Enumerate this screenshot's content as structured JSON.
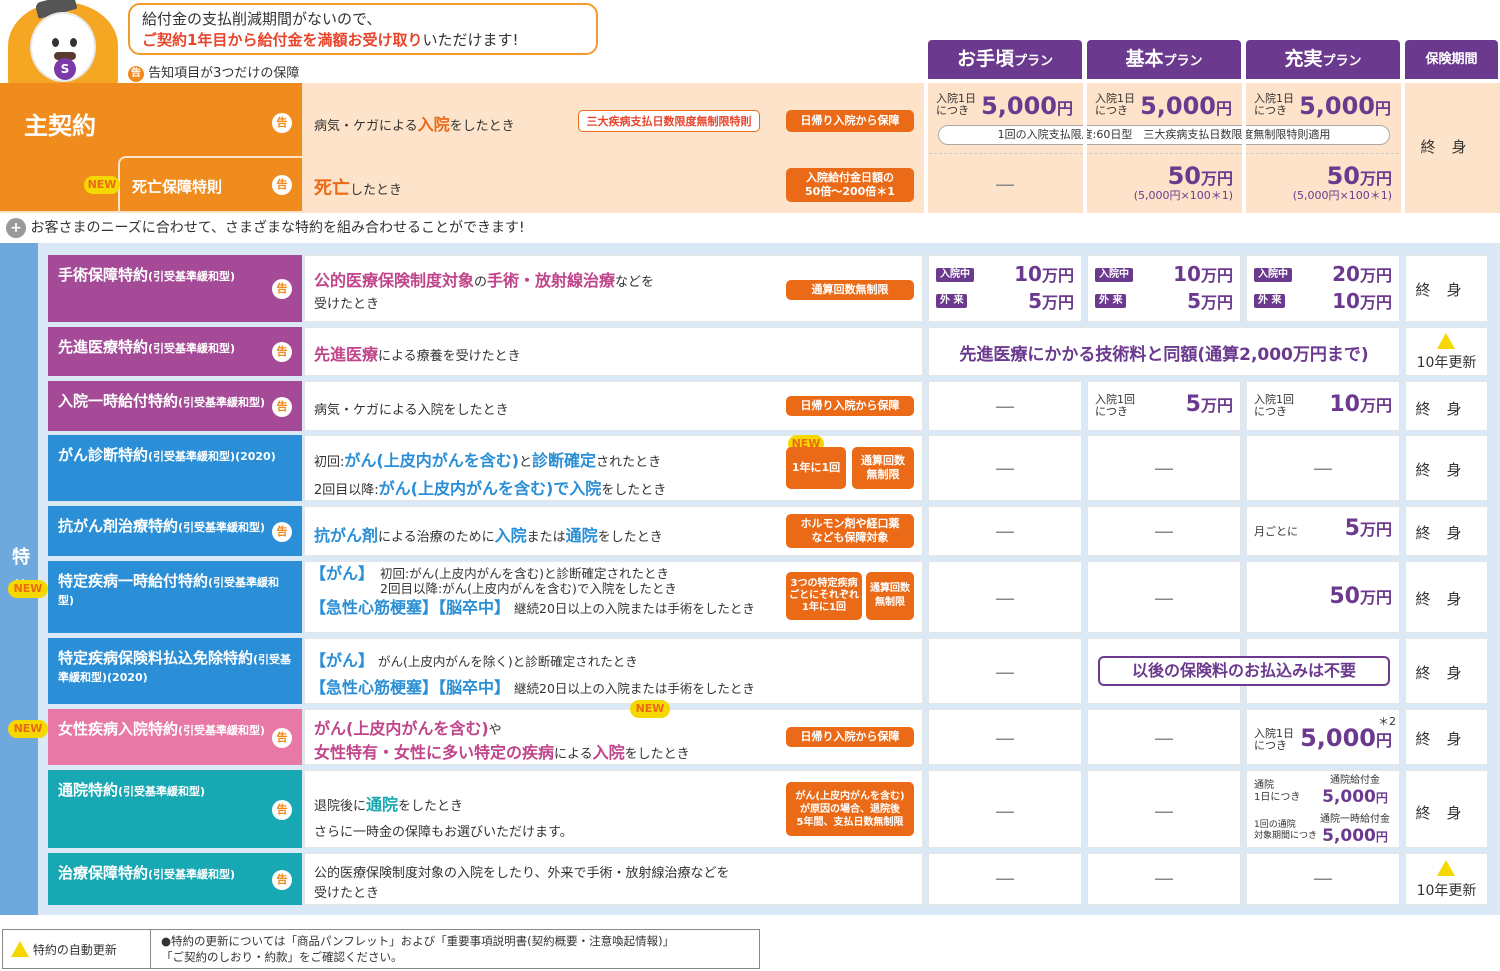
{
  "header": {
    "bubble_line1": "給付金の支払削減期間がないので、",
    "bubble_line2_hl": "ご契約1年目から給付金を満額お受け取り",
    "bubble_line2_rest": "いただけます!",
    "notice": "告知項目が3つだけの保障",
    "mascot_badge": "S",
    "kokuchi_icon": "告",
    "plans": [
      {
        "name": "お手頃",
        "suffix": "プラン"
      },
      {
        "name": "基本",
        "suffix": "プラン"
      },
      {
        "name": "充実",
        "suffix": "プラン"
      }
    ],
    "period_label": "保険期間"
  },
  "main": {
    "label": "主契約",
    "desc_pre": "病気・ケガによる",
    "desc_hl": "入院",
    "desc_post": "をしたとき",
    "tag1": "三大疾病支払日数限度無制限特則",
    "tag2": "日帰り入院から保障",
    "per_day": "入院1日",
    "per_day2": "につき",
    "amount": "5,000",
    "unit": "円",
    "limit_note": "1回の入院支払限度:60日型　三大疾病支払日数限度無制限特則適用",
    "term": "終身",
    "death": {
      "new": "NEW",
      "label": "死亡保障特則",
      "desc_hl": "死亡",
      "desc_post": "したとき",
      "tag": "入院給付金日額の",
      "tag2": "50倍〜200倍＊1",
      "dash": "—",
      "amount": "50",
      "unit": "万円",
      "note": "(5,000円×100＊1)"
    }
  },
  "combo_note": "お客さまのニーズに合わせて、さまざまな特約を組み合わせることができます!",
  "side_label": "特約",
  "riders": [
    {
      "label": "手術保障特約",
      "sub": "(引受基準緩和型)"
    },
    {
      "label": "先進医療特約",
      "sub": "(引受基準緩和型)"
    },
    {
      "label": "入院一時給付特約",
      "sub": "(引受基準緩和型)"
    },
    {
      "label": "がん診断特約",
      "sub": "(引受基準緩和型)(2020)"
    },
    {
      "label": "抗がん剤治療特約",
      "sub": "(引受基準緩和型)"
    },
    {
      "label": "特定疾病一時給付特約",
      "sub": "(引受基準緩和型)"
    },
    {
      "label": "特定疾病保険料払込免除特約",
      "sub": "(引受基準緩和型)(2020)"
    },
    {
      "label": "女性疾病入院特約",
      "sub": "(引受基準緩和型)"
    },
    {
      "label": "通院特約",
      "sub": "(引受基準緩和型)"
    },
    {
      "label": "治療保障特約",
      "sub": "(引受基準緩和型)"
    }
  ],
  "r1": {
    "d1": "公的医療保険制度対象",
    "d2": "の",
    "d3": "手術・放射線治療",
    "d4": "などを",
    "d5": "受けたとき",
    "tag": "通算回数無制限",
    "in": "入院中",
    "out": "外 来",
    "a1": "10",
    "a2": "5",
    "b1": "10",
    "b2": "5",
    "c1": "20",
    "c2": "10",
    "u": "万円",
    "term": "終身"
  },
  "r2": {
    "d1": "先進医療",
    "d2": "による療養を受けたとき",
    "span": "先進医療にかかる技術料と同額(通算2,000万円まで)",
    "term": "10年更新"
  },
  "r3": {
    "d1": "病気・ケガによる入院をしたとき",
    "tag": "日帰り入院から保障",
    "dash": "—",
    "per": "入院1回",
    "per2": "につき",
    "b": "5",
    "c": "10",
    "u": "万円",
    "term": "終身"
  },
  "r4": {
    "l1a": "初回:",
    "l1b": "がん(上皮内がんを含む)",
    "l1c": "と",
    "l1d": "診断確定",
    "l1e": "されたとき",
    "l2a": "2回目以降:",
    "l2b": "がん(上皮内がんを含む)で入院",
    "l2c": "をしたとき",
    "new": "NEW",
    "tag1": "1年に1回",
    "tag2a": "通算回数",
    "tag2b": "無制限",
    "dash": "—",
    "term": "終身"
  },
  "r5": {
    "d1": "抗がん剤",
    "d2": "による治療のために",
    "d3": "入院",
    "d4": "または",
    "d5": "通院",
    "d6": "をしたとき",
    "tag1": "ホルモン剤や経口薬",
    "tag2": "なども保障対象",
    "dash": "—",
    "per": "月ごとに",
    "c": "5",
    "u": "万円",
    "term": "終身"
  },
  "r6": {
    "new": "NEW",
    "k1": "【がん】",
    "l1": "初回:がん(上皮内がんを含む)と診断確定されたとき",
    "l2": "2回目以降:がん(上皮内がんを含む)で入院をしたとき",
    "k2": "【急性心筋梗塞】【脳卒中】",
    "l3": "継続20日以上の入院または手術をしたとき",
    "tag1a": "3つの特定疾病",
    "tag1b": "ごとにそれぞれ",
    "tag1c": "1年に1回",
    "tag2a": "通算回数",
    "tag2b": "無制限",
    "dash": "—",
    "c": "50",
    "u": "万円",
    "term": "終身"
  },
  "r7": {
    "k1": "【がん】",
    "l1": "がん(上皮内がんを除く)と診断確定されたとき",
    "k2": "【急性心筋梗塞】【脳卒中】",
    "l2": "継続20日以上の入院または手術をしたとき",
    "dash": "—",
    "span": "以後の保険料のお払込みは不要",
    "new": "NEW",
    "term": "終身"
  },
  "r8": {
    "new": "NEW",
    "d1": "がん(上皮内がんを含む)",
    "d2": "や",
    "d3": "女性特有・女性に多い特定の疾病",
    "d4": "による",
    "d5": "入院",
    "d6": "をしたとき",
    "tag": "日帰り入院から保障",
    "dash": "—",
    "per": "入院1日",
    "per2": "につき",
    "c": "5,000",
    "u": "円",
    "star": "＊2",
    "term": "終身"
  },
  "r9": {
    "d1": "退院後に",
    "d2": "通院",
    "d3": "をしたとき",
    "d4": "さらに一時金の保障もお選びいただけます。",
    "tag1": "がん(上皮内がんを含む)",
    "tag2": "が原因の場合、退院後",
    "tag3": "5年間、支払日数無制限",
    "dash": "—",
    "p1": "通院",
    "p1b": "1日につき",
    "p1c": "通院給付金",
    "p2": "1回の通院",
    "p2b": "対象期間につき",
    "p2c": "通院一時給付金",
    "amt": "5,000",
    "u": "円",
    "term": "終身"
  },
  "r10": {
    "d1": "公的医療保険制度対象の入院をしたり、外来で手術・放射線治療などを",
    "d2": "受けたとき",
    "dash": "—",
    "term": "10年更新"
  },
  "footer": {
    "label": "特約の自動更新",
    "t1": "●特約の更新については「商品パンフレット」および「重要事項説明書(契約概要・注意喚起情報)」",
    "t2": "「ご契約のしおり・約款」をご確認ください。"
  },
  "colors": {
    "orange": "#ef8c1d",
    "purple": "#6b3a8f",
    "pink": "#c0458a",
    "blue": "#2a8fd6",
    "teal": "#18a8b3"
  }
}
